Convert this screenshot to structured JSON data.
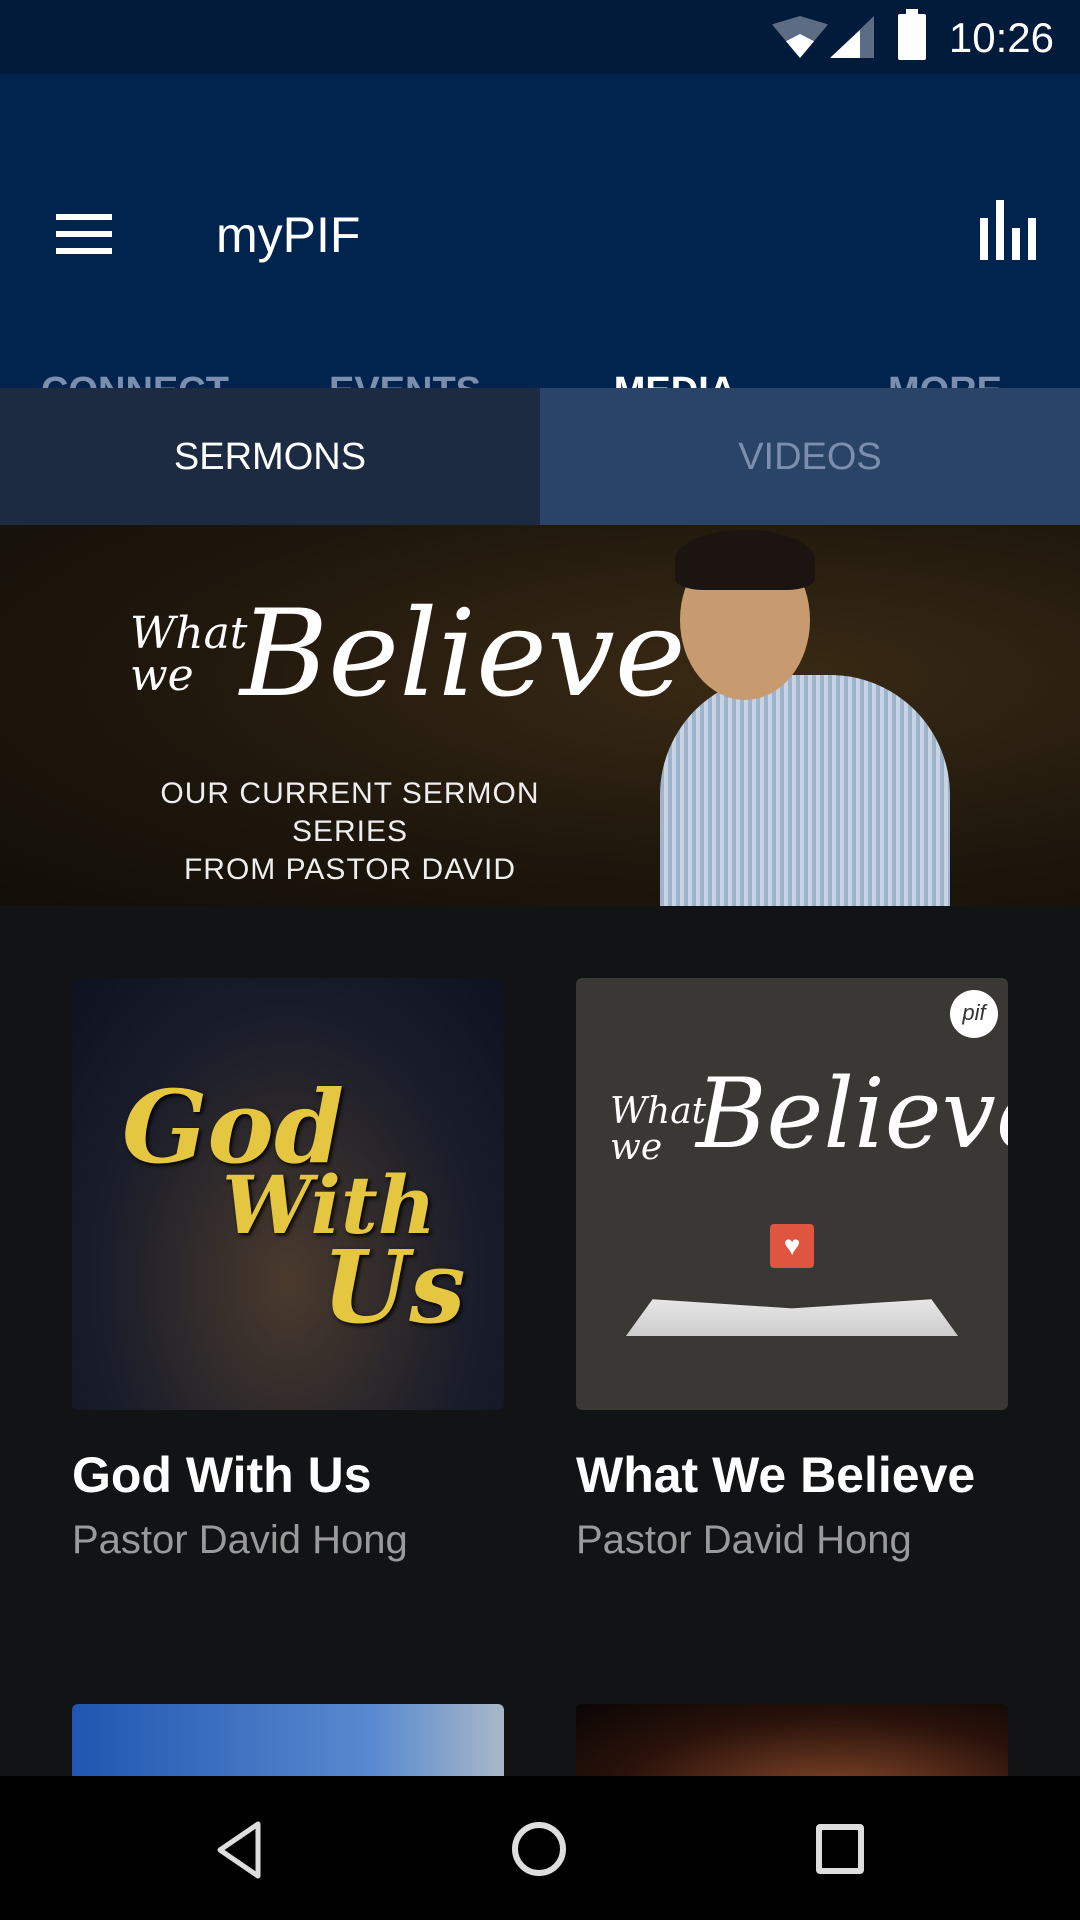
{
  "status_bar": {
    "time": "10:26",
    "icons": [
      "wifi-icon",
      "cell-signal-icon",
      "battery-icon"
    ]
  },
  "app_bar": {
    "title": "myPIF",
    "menu_icon": "hamburger-menu-icon",
    "action_icon": "bar-chart-icon"
  },
  "tabs": [
    {
      "label": "CONNECT"
    },
    {
      "label": "EVENTS"
    },
    {
      "label": "MEDIA",
      "active": true
    },
    {
      "label": "MORE"
    }
  ],
  "sub_tabs": [
    {
      "label": "SERMONS",
      "active": true
    },
    {
      "label": "VIDEOS"
    }
  ],
  "banner": {
    "small": "What we",
    "big": "Believe",
    "subtitle_line1": "OUR CURRENT SERMON SERIES",
    "subtitle_line2": "FROM PASTOR DAVID"
  },
  "series": [
    {
      "title": "God With Us",
      "speaker": "Pastor David Hong",
      "art": {
        "w1": "God",
        "w2": "With",
        "w3": "Us"
      }
    },
    {
      "title": "What We Believe",
      "speaker": "Pastor David Hong",
      "art": {
        "small": "What we",
        "big": "Believe",
        "badge": "pif"
      }
    }
  ],
  "nav_bar": {
    "icons": [
      "back-icon",
      "home-icon",
      "recent-apps-icon"
    ]
  },
  "colors": {
    "status_bar": "#021b3a",
    "app_bar": "#01244f",
    "sub_tab_active": "#1c2a42",
    "sub_tab_inactive": "#2a4468",
    "background": "#111315",
    "inactive_text": "#7b8ead"
  }
}
